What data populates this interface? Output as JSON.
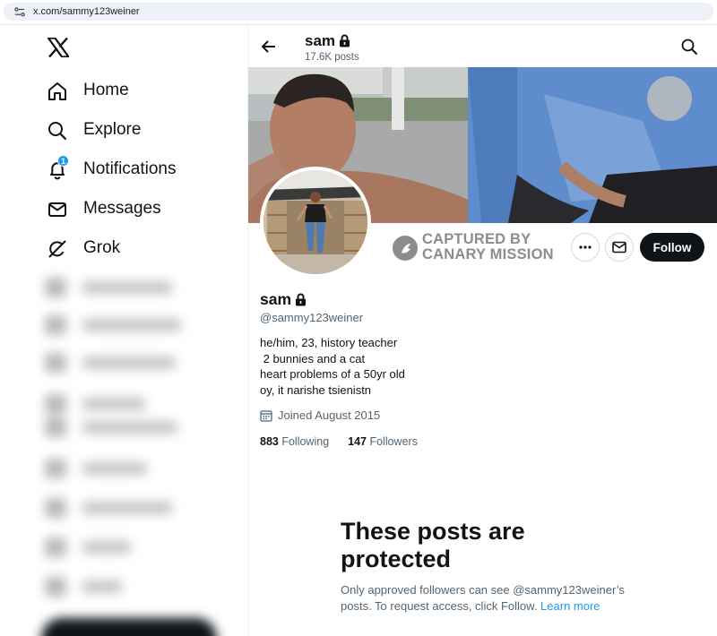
{
  "browser": {
    "url": "x.com/sammy123weiner"
  },
  "nav": {
    "items": [
      {
        "label": "Home",
        "icon": "home-icon"
      },
      {
        "label": "Explore",
        "icon": "search-icon"
      },
      {
        "label": "Notifications",
        "icon": "bell-icon",
        "badge": "1"
      },
      {
        "label": "Messages",
        "icon": "envelope-icon"
      },
      {
        "label": "Grok",
        "icon": "grok-icon"
      }
    ]
  },
  "header": {
    "name": "sam",
    "post_count": "17.6K posts"
  },
  "watermark": {
    "line1": "CAPTURED BY",
    "line2": "CANARY MISSION"
  },
  "actions": {
    "follow_label": "Follow"
  },
  "profile": {
    "name": "sam",
    "handle": "@sammy123weiner",
    "bio": [
      "he/him, 23, history teacher",
      " 2 bunnies and a cat",
      "heart problems of a 50yr old",
      "oy, it narishe tsienistn"
    ],
    "joined": "Joined August 2015",
    "following_count": "883",
    "following_label": "Following",
    "followers_count": "147",
    "followers_label": "Followers"
  },
  "protected": {
    "title": "These posts are protected",
    "description": "Only approved followers can see @sammy123weiner’s posts. To request access, click Follow.",
    "learn_more": "Learn more"
  },
  "colors": {
    "accent": "#1d9bf0",
    "text": "#0f1419",
    "secondary_text": "#536471",
    "follow_button": "#0f1419"
  }
}
